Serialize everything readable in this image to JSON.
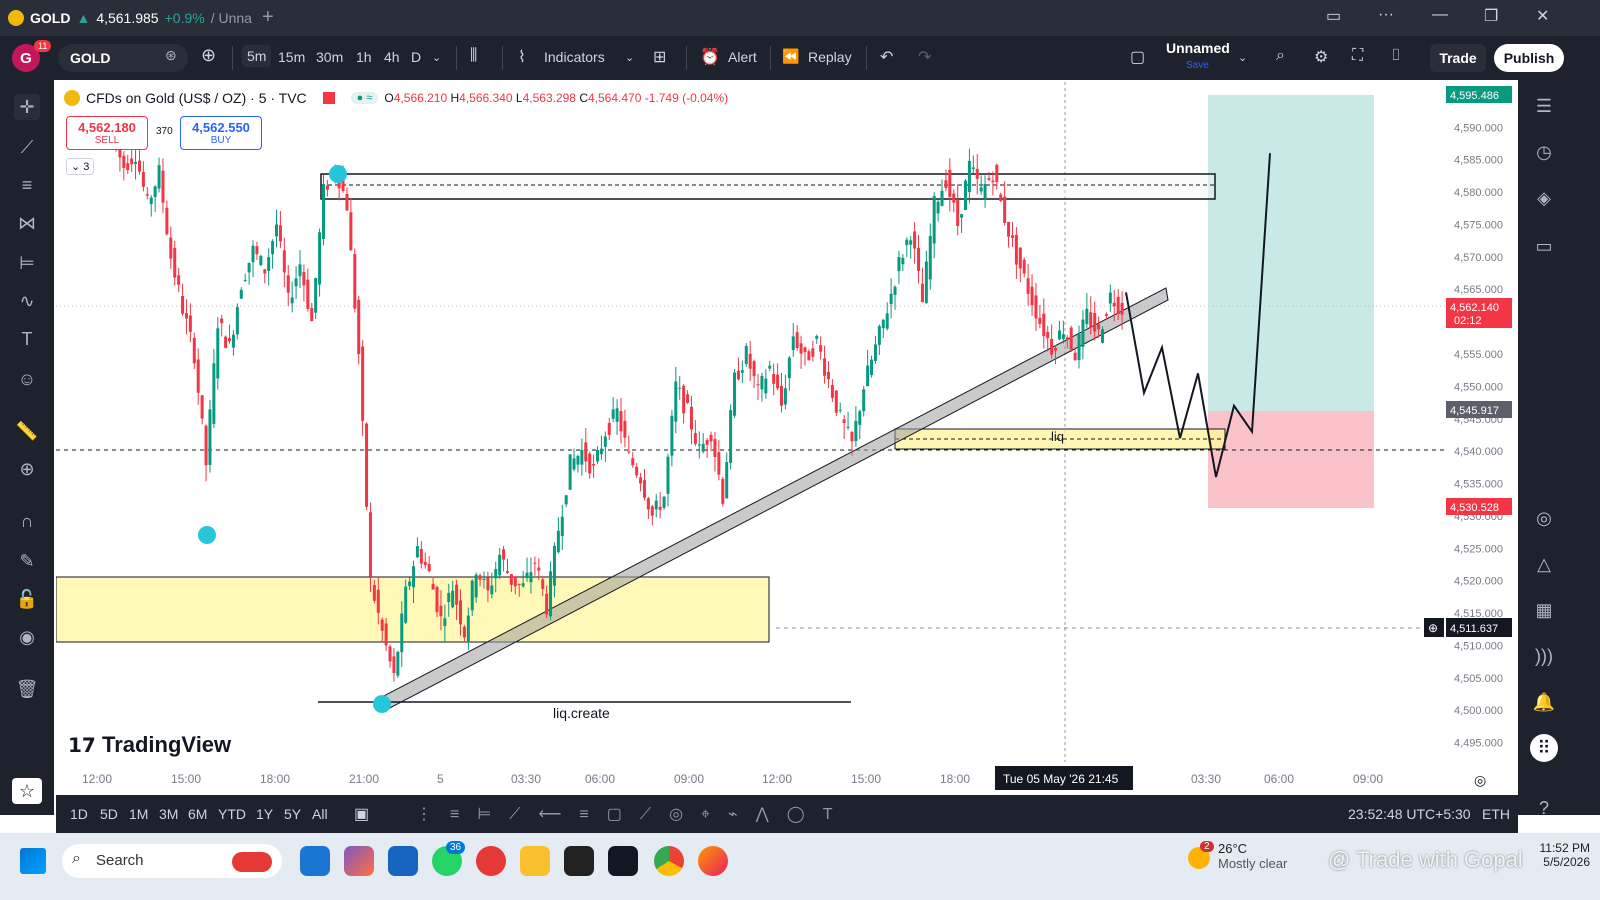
{
  "window": {
    "tab_symbol": "GOLD",
    "tab_arrow": "▲",
    "tab_price": "4,561.985",
    "tab_change": "+0.9%",
    "tab_rest": "/ Unna"
  },
  "toolbar": {
    "avatar_letter": "G",
    "avatar_badge": "11",
    "symbol": "GOLD",
    "intervals": [
      "5m",
      "15m",
      "30m",
      "1h",
      "4h",
      "D"
    ],
    "active_interval": "5m",
    "indicators": "Indicators",
    "alert": "Alert",
    "replay": "Replay",
    "layout_name": "Unnamed",
    "layout_save": "Save",
    "trade": "Trade",
    "publish": "Publish"
  },
  "legend": {
    "title": "CFDs on Gold (US$ / OZ) · 5 · TVC",
    "open_label": "O",
    "open": "4,566.210",
    "high_label": "H",
    "high": "4,566.340",
    "low_label": "L",
    "low": "4,563.298",
    "close_label": "C",
    "close": "4,564.470",
    "change": "-1.749 (-0.04%)",
    "sell_price": "4,562.180",
    "sell_label": "SELL",
    "spread": "370",
    "buy_price": "4,562.550",
    "buy_label": "BUY",
    "collapsed_count": "3"
  },
  "chart_data": {
    "type": "candlestick",
    "title": "CFDs on Gold (US$ / OZ)",
    "y_ticks": [
      "4,595.000",
      "4,590.000",
      "4,585.000",
      "4,580.000",
      "4,575.000",
      "4,570.000",
      "4,565.000",
      "4,560.000",
      "4,555.000",
      "4,550.000",
      "4,545.000",
      "4,540.000",
      "4,535.000",
      "4,530.000",
      "4,525.000",
      "4,520.000",
      "4,515.000",
      "4,510.000",
      "4,505.000",
      "4,500.000",
      "4,495.000"
    ],
    "ylim": [
      4492,
      4597
    ],
    "x_ticks": [
      "12:00",
      "15:00",
      "18:00",
      "21:00",
      "5",
      "03:30",
      "06:00",
      "09:00",
      "12:00",
      "15:00",
      "18:00",
      "03:30",
      "06:00",
      "09:00"
    ],
    "crosshair_time": "Tue 05 May '26  21:45",
    "price_labels": {
      "target": "4,595.486",
      "current": "4,562.140",
      "countdown": "02:12",
      "entry": "4,545.917",
      "stop": "4,530.528",
      "cursor": "4,511.637"
    },
    "annotations": [
      "liq",
      "liq.create"
    ],
    "watermark": "TradingView",
    "path_series": [
      [
        0,
        4588
      ],
      [
        1,
        4584
      ],
      [
        2,
        4586
      ],
      [
        3,
        4578
      ],
      [
        4,
        4583
      ],
      [
        5,
        4570
      ],
      [
        6,
        4562
      ],
      [
        7,
        4555
      ],
      [
        8,
        4538
      ],
      [
        9,
        4560
      ],
      [
        10,
        4556
      ],
      [
        11,
        4566
      ],
      [
        12,
        4571
      ],
      [
        13,
        4568
      ],
      [
        14,
        4575
      ],
      [
        15,
        4563
      ],
      [
        16,
        4569
      ],
      [
        17,
        4560
      ],
      [
        18,
        4580
      ],
      [
        19,
        4584
      ],
      [
        20,
        4578
      ],
      [
        21,
        4555
      ],
      [
        22,
        4520
      ],
      [
        23,
        4512
      ],
      [
        24,
        4505
      ],
      [
        25,
        4518
      ],
      [
        26,
        4525
      ],
      [
        27,
        4521
      ],
      [
        28,
        4514
      ],
      [
        29,
        4519
      ],
      [
        30,
        4512
      ],
      [
        31,
        4522
      ],
      [
        32,
        4518
      ],
      [
        33,
        4524
      ],
      [
        34,
        4520
      ],
      [
        35,
        4519
      ],
      [
        36,
        4523
      ],
      [
        37,
        4516
      ],
      [
        38,
        4528
      ],
      [
        39,
        4538
      ],
      [
        40,
        4540
      ],
      [
        41,
        4537
      ],
      [
        42,
        4543
      ],
      [
        43,
        4546
      ],
      [
        44,
        4539
      ],
      [
        45,
        4536
      ],
      [
        46,
        4530
      ],
      [
        47,
        4533
      ],
      [
        48,
        4550
      ],
      [
        49,
        4546
      ],
      [
        50,
        4540
      ],
      [
        51,
        4543
      ],
      [
        52,
        4533
      ],
      [
        53,
        4551
      ],
      [
        54,
        4555
      ],
      [
        55,
        4549
      ],
      [
        56,
        4553
      ],
      [
        57,
        4547
      ],
      [
        58,
        4558
      ],
      [
        59,
        4554
      ],
      [
        60,
        4557
      ],
      [
        61,
        4551
      ],
      [
        62,
        4545
      ],
      [
        63,
        4541
      ],
      [
        64,
        4550
      ],
      [
        65,
        4556
      ],
      [
        66,
        4562
      ],
      [
        67,
        4569
      ],
      [
        68,
        4574
      ],
      [
        69,
        4563
      ],
      [
        70,
        4578
      ],
      [
        71,
        4582
      ],
      [
        72,
        4575
      ],
      [
        73,
        4584
      ],
      [
        74,
        4580
      ],
      [
        75,
        4583
      ],
      [
        76,
        4576
      ],
      [
        77,
        4570
      ],
      [
        78,
        4565
      ],
      [
        79,
        4560
      ],
      [
        80,
        4556
      ],
      [
        81,
        4559
      ],
      [
        82,
        4555
      ],
      [
        83,
        4561
      ],
      [
        84,
        4558
      ],
      [
        85,
        4564
      ],
      [
        86,
        4562
      ]
    ],
    "projection": [
      [
        4564.5,
        0
      ],
      [
        4549,
        1
      ],
      [
        4556,
        2
      ],
      [
        4542,
        3
      ],
      [
        4552,
        4
      ],
      [
        4536,
        5
      ],
      [
        4547,
        6
      ],
      [
        4543,
        7
      ],
      [
        4586,
        8
      ]
    ]
  },
  "bottombar": {
    "ranges": [
      "1D",
      "5D",
      "1M",
      "3M",
      "6M",
      "YTD",
      "1Y",
      "5Y",
      "All"
    ],
    "time": "23:52:48 UTC+5:30",
    "session": "ETH"
  },
  "taskbar": {
    "search": "Search",
    "whatsapp_badge": "36",
    "weather_badge": "2",
    "temperature": "26°C",
    "weather_text": "Mostly clear",
    "clock_time": "11:52 PM",
    "clock_date": "5/5/2026",
    "watermark": "@ Trade with Gopal"
  }
}
